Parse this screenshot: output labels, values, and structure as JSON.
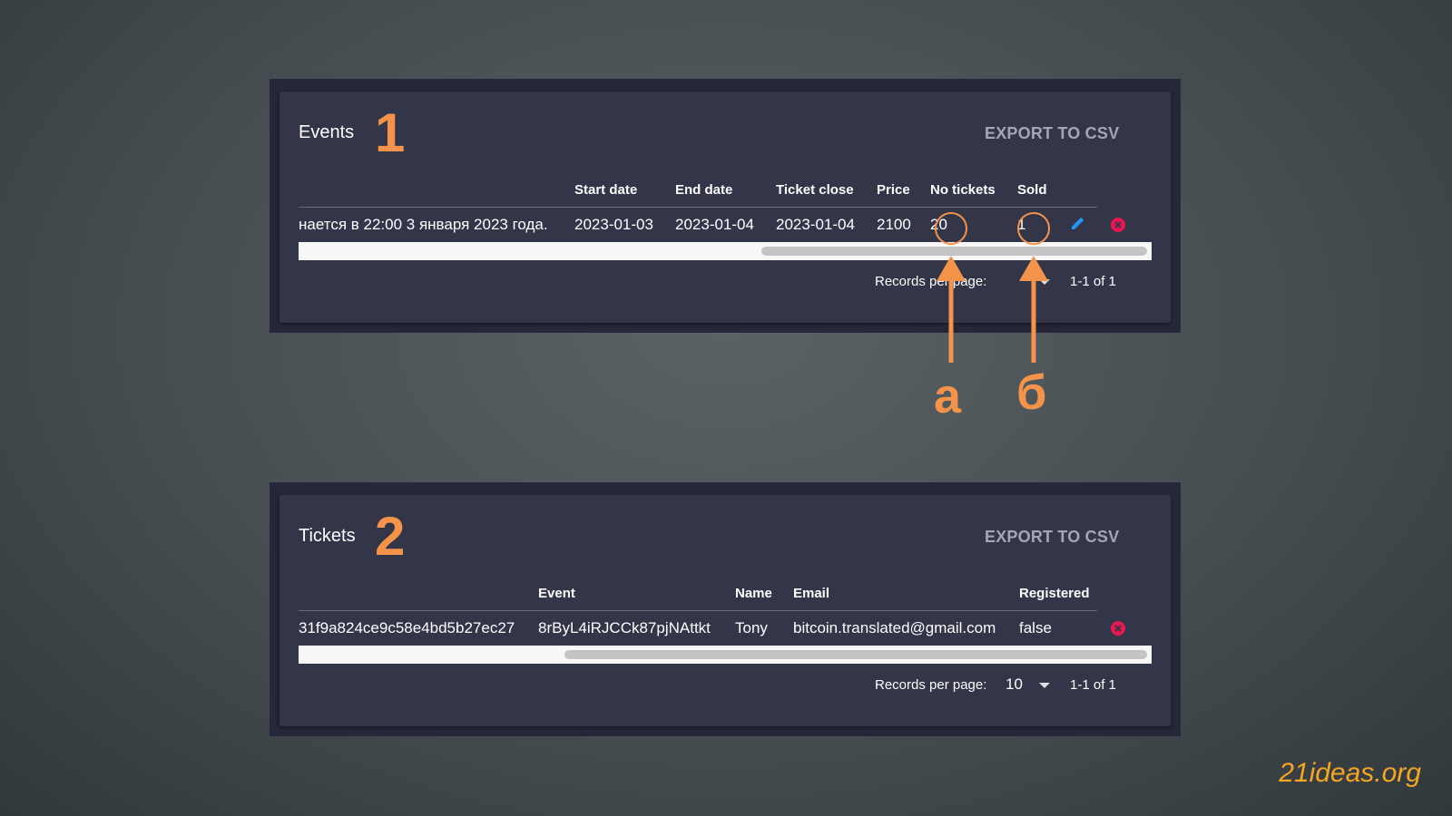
{
  "events": {
    "title": "Events",
    "marker": "1",
    "export_label": "EXPORT TO CSV",
    "columns": [
      "Start date",
      "End date",
      "Ticket close",
      "Price",
      "No tickets",
      "Sold"
    ],
    "row": {
      "name": "нается в 22:00 3 января 2023 года.",
      "start_date": "2023-01-03",
      "end_date": "2023-01-04",
      "ticket_close": "2023-01-04",
      "price": "2100",
      "no_tickets": "20",
      "sold": "1"
    },
    "footer": {
      "records_label": "Records per page:",
      "range": "1-1 of 1"
    },
    "icons": [
      "pencil-icon",
      "delete-circle-icon"
    ]
  },
  "tickets": {
    "title": "Tickets",
    "marker": "2",
    "export_label": "EXPORT TO CSV",
    "columns": [
      "Event",
      "Name",
      "Email",
      "Registered"
    ],
    "row": {
      "id": "31f9a824ce9c58e4bd5b27ec27",
      "event": "8rByL4iRJCCk87pjNAttkt",
      "name": "Tony",
      "email": "bitcoin.translated@gmail.com",
      "registered": "false"
    },
    "footer": {
      "records_label": "Records per page:",
      "per_page": "10",
      "range": "1-1 of 1"
    },
    "icons": [
      "delete-circle-icon"
    ]
  },
  "annotations": {
    "a": "а",
    "b": "б"
  },
  "watermark": "21ideas.org",
  "colors": {
    "accent": "#f5934a",
    "panel": "#333548",
    "delete": "#e5194f",
    "edit": "#2196f3"
  }
}
